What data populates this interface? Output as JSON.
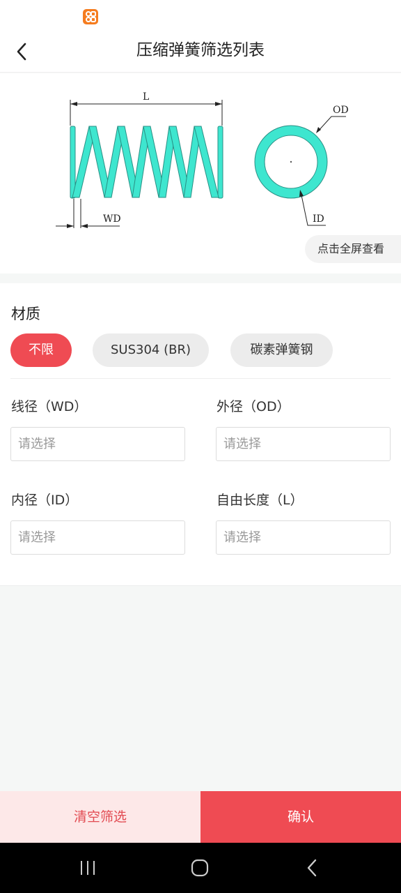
{
  "status_bar": {
    "app_icon": "app-notification-icon"
  },
  "header": {
    "title": "压缩弹簧筛选列表",
    "back_icon": "chevron-left-icon"
  },
  "diagram": {
    "labels": {
      "length": "L",
      "outer_diameter": "OD",
      "wire_diameter": "WD",
      "inner_diameter": "ID"
    },
    "spring_color": "#3ee6cf",
    "fullscreen_label": "点击全屏查看"
  },
  "filters": {
    "material": {
      "title": "材质",
      "options": [
        {
          "label": "不限",
          "selected": true
        },
        {
          "label": "SUS304 (BR)",
          "selected": false
        },
        {
          "label": "碳素弹簧钢",
          "selected": false
        }
      ]
    },
    "fields": [
      {
        "label": "线径（WD）",
        "placeholder": "请选择",
        "value": ""
      },
      {
        "label": "外径（OD）",
        "placeholder": "请选择",
        "value": ""
      },
      {
        "label": "内径（ID）",
        "placeholder": "请选择",
        "value": ""
      },
      {
        "label": "自由长度（L）",
        "placeholder": "请选择",
        "value": ""
      }
    ]
  },
  "actions": {
    "clear_label": "清空筛选",
    "confirm_label": "确认"
  },
  "colors": {
    "accent": "#ef4b53",
    "accent_light": "#fde8e8",
    "chip_bg": "#ececec"
  },
  "system_nav": {
    "recents_icon": "recents-icon",
    "home_icon": "home-icon",
    "back_icon": "back-icon"
  }
}
